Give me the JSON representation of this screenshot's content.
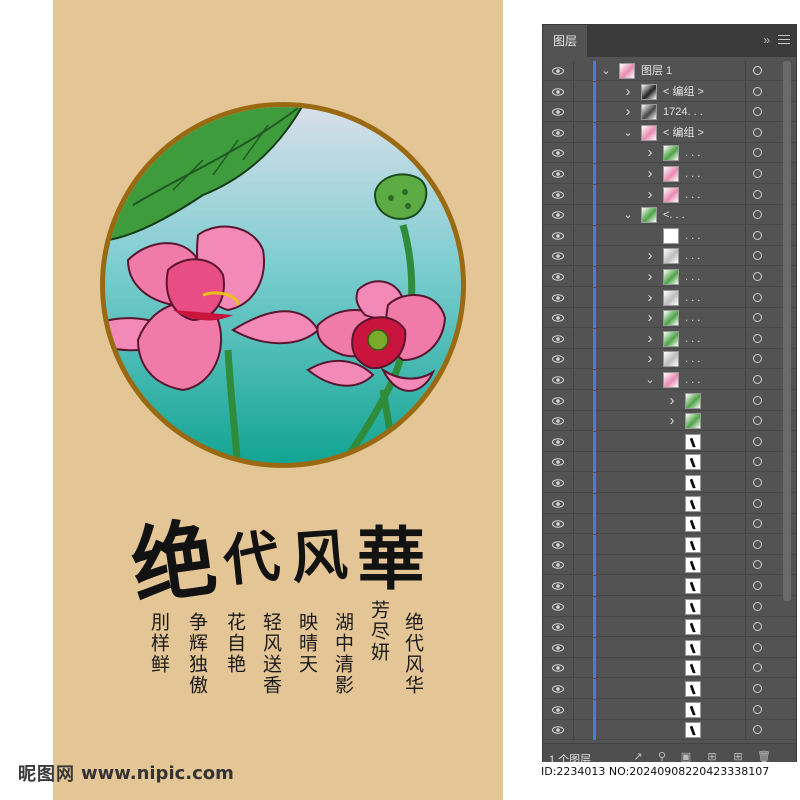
{
  "artwork": {
    "title_chars": [
      "绝",
      "代",
      "风",
      "華"
    ],
    "poem_columns": [
      "绝代风华",
      "芳尽妍",
      "湖中清影",
      "映晴天",
      "轻风送香",
      "花自艳",
      "争辉独傲",
      "刖样鲜"
    ],
    "colors": {
      "background": "#e4c596",
      "frame": "#9a6a12",
      "sky_top": "#d4dde8",
      "water": "#17a89a",
      "lotus": "#f07aa8",
      "lotus_dark": "#c9153e",
      "leaf": "#3a9a3e"
    }
  },
  "watermark": {
    "logo": "昵图网",
    "site": "www.nipic.com"
  },
  "panel": {
    "tab": "图层",
    "collapse_icon": "double-chevron-icon",
    "menu_icon": "hamburger-icon",
    "layers": [
      {
        "name": "图层 1",
        "twirl": "down",
        "indent": 0,
        "thumb": "lotus-thumb",
        "selected": true
      },
      {
        "name": "< 编组 >",
        "twirl": "right",
        "indent": 1,
        "thumb": "line-thumb"
      },
      {
        "name": "1724. . .",
        "twirl": "right",
        "indent": 1,
        "thumb": "text-thumb"
      },
      {
        "name": "< 编组 >",
        "twirl": "down",
        "indent": 1,
        "thumb": "lotus-thumb"
      },
      {
        "name": ". . .",
        "twirl": "right",
        "indent": 2,
        "thumb": "leaf-thumb"
      },
      {
        "name": ". . .",
        "twirl": "right",
        "indent": 2,
        "thumb": "lotus-thumb"
      },
      {
        "name": ". . .",
        "twirl": "right",
        "indent": 2,
        "thumb": "lotus-thumb"
      },
      {
        "name": "<. . .",
        "twirl": "down",
        "indent": 1,
        "thumb": "leaf-thumb"
      },
      {
        "name": ". . .",
        "twirl": "none",
        "indent": 2,
        "thumb": "circle-thumb"
      },
      {
        "name": ". . .",
        "twirl": "right",
        "indent": 2,
        "thumb": "outline-thumb"
      },
      {
        "name": ". . .",
        "twirl": "right",
        "indent": 2,
        "thumb": "leaf-thumb"
      },
      {
        "name": ". . .",
        "twirl": "right",
        "indent": 2,
        "thumb": "outline-thumb"
      },
      {
        "name": ". . .",
        "twirl": "right",
        "indent": 2,
        "thumb": "leaf-thumb"
      },
      {
        "name": ". . .",
        "twirl": "right",
        "indent": 2,
        "thumb": "leaf-thumb"
      },
      {
        "name": ". . .",
        "twirl": "right",
        "indent": 2,
        "thumb": "outline-thumb"
      },
      {
        "name": ". . .",
        "twirl": "down",
        "indent": 2,
        "thumb": "lotus-thumb"
      },
      {
        "name": "",
        "twirl": "right",
        "indent": 3,
        "thumb": "leaf-thumb"
      },
      {
        "name": "",
        "twirl": "right",
        "indent": 3,
        "thumb": "leaf-thumb"
      },
      {
        "name": "",
        "twirl": "none",
        "indent": 3,
        "thumb": "stroke-thumb"
      },
      {
        "name": "",
        "twirl": "none",
        "indent": 3,
        "thumb": "stroke-thumb"
      },
      {
        "name": "",
        "twirl": "none",
        "indent": 3,
        "thumb": "stroke-thumb"
      },
      {
        "name": "",
        "twirl": "none",
        "indent": 3,
        "thumb": "stroke-thumb"
      },
      {
        "name": "",
        "twirl": "none",
        "indent": 3,
        "thumb": "stroke-thumb"
      },
      {
        "name": "",
        "twirl": "none",
        "indent": 3,
        "thumb": "stroke-thumb"
      },
      {
        "name": "",
        "twirl": "none",
        "indent": 3,
        "thumb": "stroke-thumb"
      },
      {
        "name": "",
        "twirl": "none",
        "indent": 3,
        "thumb": "stroke-thumb"
      },
      {
        "name": "",
        "twirl": "none",
        "indent": 3,
        "thumb": "stroke-thumb"
      },
      {
        "name": "",
        "twirl": "none",
        "indent": 3,
        "thumb": "stroke-thumb"
      },
      {
        "name": "",
        "twirl": "none",
        "indent": 3,
        "thumb": "stroke-thumb"
      },
      {
        "name": "",
        "twirl": "none",
        "indent": 3,
        "thumb": "stroke-thumb"
      },
      {
        "name": "",
        "twirl": "none",
        "indent": 3,
        "thumb": "stroke-thumb"
      },
      {
        "name": "",
        "twirl": "none",
        "indent": 3,
        "thumb": "stroke-thumb"
      },
      {
        "name": "",
        "twirl": "none",
        "indent": 3,
        "thumb": "stroke-thumb"
      },
      {
        "name": "",
        "twirl": "none",
        "indent": 3,
        "thumb": "stroke-thumb"
      }
    ],
    "footer": {
      "layer_count": "1 个图层",
      "icons": [
        "export-icon",
        "search-icon",
        "clip-mask-icon",
        "new-sublayer-icon",
        "new-layer-icon",
        "delete-icon"
      ]
    }
  },
  "id_text": "ID:2234013 NO:20240908220423338107"
}
